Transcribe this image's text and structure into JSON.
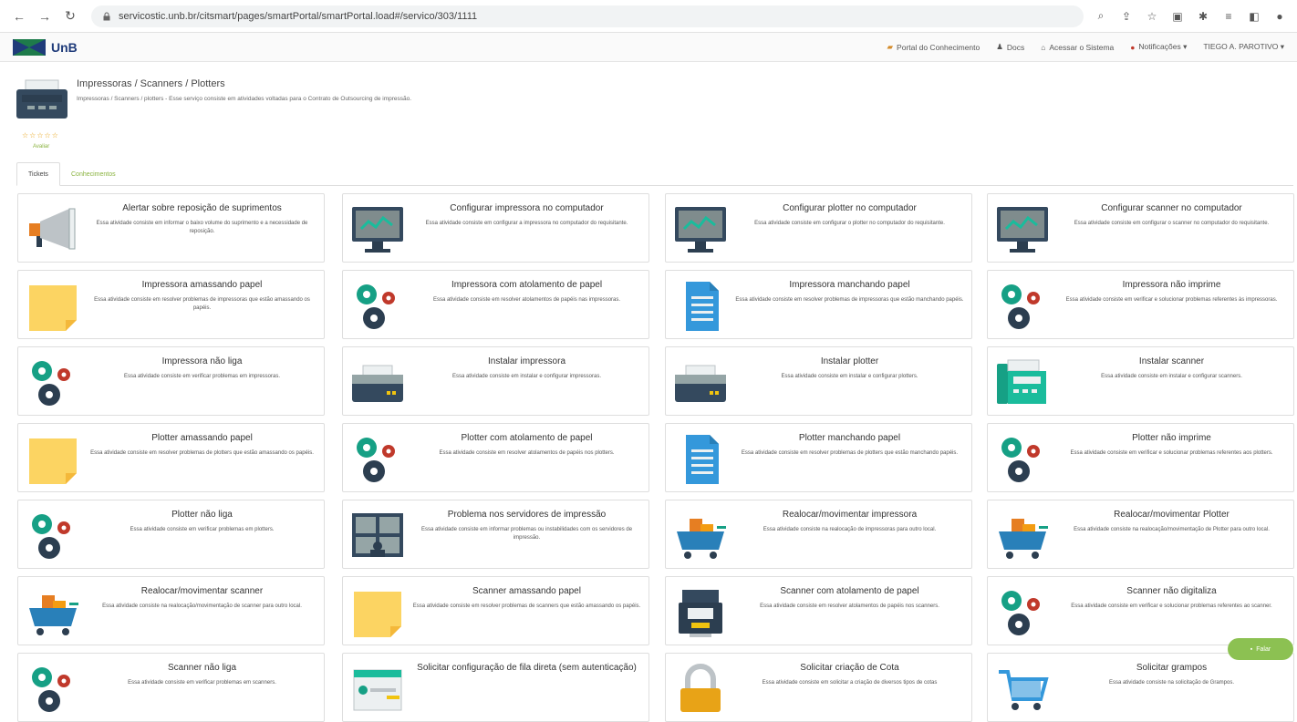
{
  "browser": {
    "url": "servicostic.unb.br/citsmart/pages/smartPortal/smartPortal.load#/servico/303/1111"
  },
  "header": {
    "logo": "UnB",
    "nav": [
      {
        "label": "Portal do Conhecimento",
        "icon": "book-icon"
      },
      {
        "label": "Docs",
        "icon": "docs-icon"
      },
      {
        "label": "Acessar o Sistema",
        "icon": "home-icon"
      },
      {
        "label": "Notificações ▾",
        "icon": "bell-icon"
      },
      {
        "label": "TIEGO A. PAROTIVO ▾",
        "icon": ""
      }
    ]
  },
  "service": {
    "title": "Impressoras / Scanners / Plotters",
    "description": "Impressoras / Scanners / plotters - Esse serviço consiste em atividades voltadas para o Contrato de Outsourcing de impressão.",
    "stars": "☆☆☆☆☆",
    "rate_label": "Avaliar"
  },
  "tabs": [
    {
      "label": "Tickets"
    },
    {
      "label": "Conhecimentos"
    }
  ],
  "cards": [
    {
      "title": "Alertar sobre reposição de suprimentos",
      "desc": "Essa atividade consiste em informar o baixo volume do suprimento e a necessidade de reposição.",
      "icon": "megaphone-icon"
    },
    {
      "title": "Configurar impressora no computador",
      "desc": "Essa atividade consiste em configurar a impressora no computador do requisitante.",
      "icon": "monitor-icon"
    },
    {
      "title": "Configurar plotter no computador",
      "desc": "Essa atividade consiste em configurar o plotter no computador do requisitante.",
      "icon": "monitor-icon"
    },
    {
      "title": "Configurar scanner no computador",
      "desc": "Essa atividade consiste em configurar o scanner no computador do requisitante.",
      "icon": "monitor-icon"
    },
    {
      "title": "Impressora amassando papel",
      "desc": "Essa atividade consiste em resolver problemas de impressoras que estão amassando os papéis.",
      "icon": "sticky-note-icon"
    },
    {
      "title": "Impressora com atolamento de papel",
      "desc": "Essa atividade consiste em resolver atolamentos de papéis nas impressoras.",
      "icon": "gears-icon"
    },
    {
      "title": "Impressora manchando papel",
      "desc": "Essa atividade consiste em resolver problemas de impressoras que estão manchando papéis.",
      "icon": "document-icon"
    },
    {
      "title": "Impressora não imprime",
      "desc": "Essa atividade consiste em verificar e solucionar problemas referentes às impressoras.",
      "icon": "gears-icon"
    },
    {
      "title": "Impressora não liga",
      "desc": "Essa atividade consiste em verificar problemas em impressoras.",
      "icon": "gears-icon"
    },
    {
      "title": "Instalar impressora",
      "desc": "Essa atividade consiste em instalar e configurar impressoras.",
      "icon": "printer-icon"
    },
    {
      "title": "Instalar plotter",
      "desc": "Essa atividade consiste em instalar e configurar plotters.",
      "icon": "printer-icon"
    },
    {
      "title": "Instalar scanner",
      "desc": "Essa atividade consiste em instalar e configurar scanners.",
      "icon": "fax-icon"
    },
    {
      "title": "Plotter amassando papel",
      "desc": "Essa atividade consiste em resolver problemas de plotters que estão amassando os papéis.",
      "icon": "sticky-note-icon"
    },
    {
      "title": "Plotter com atolamento de papel",
      "desc": "Essa atividade consiste em resolver atolamentos de papéis nos plotters.",
      "icon": "gears-icon"
    },
    {
      "title": "Plotter manchando papel",
      "desc": "Essa atividade consiste em resolver problemas de plotters que estão manchando papéis.",
      "icon": "document-icon"
    },
    {
      "title": "Plotter não imprime",
      "desc": "Essa atividade consiste em verificar e solucionar problemas referentes aos plotters.",
      "icon": "gears-icon"
    },
    {
      "title": "Plotter não liga",
      "desc": "Essa atividade consiste em verificar problemas em plotters.",
      "icon": "gears-icon"
    },
    {
      "title": "Problema nos servidores de impressão",
      "desc": "Essa atividade consiste em informar problemas ou instabilidades com os servidores de impressão.",
      "icon": "monitoring-screens-icon"
    },
    {
      "title": "Realocar/movimentar impressora",
      "desc": "Essa atividade consiste na realocação de impressoras para outro local.",
      "icon": "cart-icon"
    },
    {
      "title": "Realocar/movimentar Plotter",
      "desc": "Essa atividade consiste na realocação/movimentação de Plotter para outro local.",
      "icon": "cart-icon"
    },
    {
      "title": "Realocar/movimentar scanner",
      "desc": "Essa atividade consiste na realocação/movimentação de scanner para outro local.",
      "icon": "cart-icon"
    },
    {
      "title": "Scanner amassando papel",
      "desc": "Essa atividade consiste em resolver problemas de scanners que estão amassando os papéis.",
      "icon": "sticky-note-icon"
    },
    {
      "title": "Scanner com atolamento de papel",
      "desc": "Essa atividade consiste em resolver atolamentos de papéis nos scanners.",
      "icon": "cash-register-icon"
    },
    {
      "title": "Scanner não digitaliza",
      "desc": "Essa atividade consiste em verificar e solucionar problemas referentes ao scanner.",
      "icon": "gears-icon"
    },
    {
      "title": "Scanner não liga",
      "desc": "Essa atividade consiste em verificar problemas em scanners.",
      "icon": "gears-icon"
    },
    {
      "title": "Solicitar configuração de fila direta (sem autenticação)",
      "desc": "",
      "icon": "checklist-icon"
    },
    {
      "title": "Solicitar criação de Cota",
      "desc": "Essa atividade consiste em solicitar a criação de diversos tipos de cotas",
      "icon": "padlock-icon"
    },
    {
      "title": "Solicitar grampos",
      "desc": "Essa atividade consiste na solicitação de Grampos.",
      "icon": "cart-outline-icon"
    }
  ],
  "chat": {
    "label": "Falar"
  },
  "colors": {
    "accent": "#8ab33f",
    "brand": "#1f3b7a",
    "icon_dark": "#34495e",
    "icon_teal": "#16a085",
    "icon_orange": "#e67e22",
    "icon_red": "#c0392b"
  }
}
